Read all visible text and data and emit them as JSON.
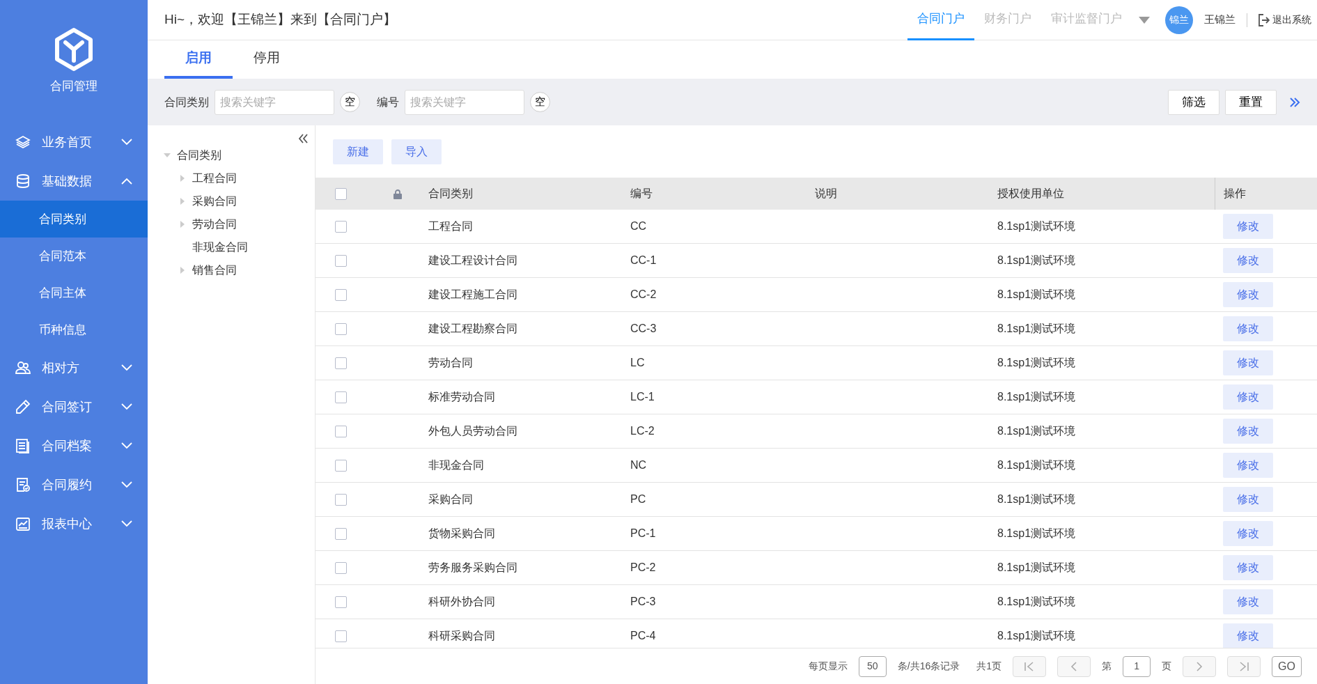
{
  "sidebar": {
    "title": "合同管理",
    "items": [
      {
        "label": "业务首页",
        "expanded": false
      },
      {
        "label": "基础数据",
        "expanded": true,
        "children": [
          {
            "label": "合同类别",
            "selected": true
          },
          {
            "label": "合同范本",
            "selected": false
          },
          {
            "label": "合同主体",
            "selected": false
          },
          {
            "label": "币种信息",
            "selected": false
          }
        ]
      },
      {
        "label": "相对方",
        "expanded": false
      },
      {
        "label": "合同签订",
        "expanded": false
      },
      {
        "label": "合同档案",
        "expanded": false
      },
      {
        "label": "合同履约",
        "expanded": false
      },
      {
        "label": "报表中心",
        "expanded": false
      }
    ]
  },
  "header": {
    "greeting": "Hi~，欢迎【王锦兰】来到【合同门户】",
    "portals": [
      {
        "label": "合同门户",
        "selected": true
      },
      {
        "label": "财务门户",
        "selected": false
      },
      {
        "label": "审计监督门户",
        "selected": false
      }
    ],
    "avatar": "锦兰",
    "user": "王锦兰",
    "logout": "退出系统"
  },
  "tabs": [
    {
      "label": "启用",
      "selected": true
    },
    {
      "label": "停用",
      "selected": false
    }
  ],
  "filters": [
    {
      "label": "合同类别",
      "placeholder": "搜索关键字",
      "clear": "空"
    },
    {
      "label": "编号",
      "placeholder": "搜索关键字",
      "clear": "空"
    }
  ],
  "filter_buttons": [
    "筛选",
    "重置"
  ],
  "tree": {
    "label": "合同类别",
    "expanded": true,
    "children": [
      {
        "label": "工程合同",
        "kind": "folder"
      },
      {
        "label": "采购合同",
        "kind": "folder"
      },
      {
        "label": "劳动合同",
        "kind": "folder"
      },
      {
        "label": "非现金合同",
        "kind": "leaf"
      },
      {
        "label": "销售合同",
        "kind": "folder"
      }
    ]
  },
  "toolbar": [
    "新建",
    "导入"
  ],
  "table": {
    "select_all_checked": false,
    "columns": [
      "合同类别",
      "编号",
      "说明",
      "授权使用单位",
      "操作"
    ],
    "rows": [
      {
        "checked": false,
        "type": "工程合同",
        "code": "CC",
        "unit": "8.1sp1测试环境",
        "action": "修改"
      },
      {
        "checked": false,
        "type": "建设工程设计合同",
        "code": "CC-1",
        "unit": "8.1sp1测试环境",
        "action": "修改"
      },
      {
        "checked": false,
        "type": "建设工程施工合同",
        "code": "CC-2",
        "unit": "8.1sp1测试环境",
        "action": "修改"
      },
      {
        "checked": false,
        "type": "建设工程勘察合同",
        "code": "CC-3",
        "unit": "8.1sp1测试环境",
        "action": "修改"
      },
      {
        "checked": false,
        "type": "劳动合同",
        "code": "LC",
        "unit": "8.1sp1测试环境",
        "action": "修改"
      },
      {
        "checked": false,
        "type": "标准劳动合同",
        "code": "LC-1",
        "unit": "8.1sp1测试环境",
        "action": "修改"
      },
      {
        "checked": false,
        "type": "外包人员劳动合同",
        "code": "LC-2",
        "unit": "8.1sp1测试环境",
        "action": "修改"
      },
      {
        "checked": false,
        "type": "非现金合同",
        "code": "NC",
        "unit": "8.1sp1测试环境",
        "action": "修改"
      },
      {
        "checked": false,
        "type": "采购合同",
        "code": "PC",
        "unit": "8.1sp1测试环境",
        "action": "修改"
      },
      {
        "checked": false,
        "type": "货物采购合同",
        "code": "PC-1",
        "unit": "8.1sp1测试环境",
        "action": "修改"
      },
      {
        "checked": false,
        "type": "劳务服务采购合同",
        "code": "PC-2",
        "unit": "8.1sp1测试环境",
        "action": "修改"
      },
      {
        "checked": false,
        "type": "科研外协合同",
        "code": "PC-3",
        "unit": "8.1sp1测试环境",
        "action": "修改"
      },
      {
        "checked": false,
        "type": "科研采购合同",
        "code": "PC-4",
        "unit": "8.1sp1测试环境",
        "action": "修改"
      }
    ]
  },
  "pagination": {
    "per_page_label": "每页显示",
    "per_page": "50",
    "records": "条/共16条记录",
    "pages": "共1页",
    "page_prefix": "第",
    "page": "1",
    "page_suffix": "页",
    "go": "GO"
  }
}
